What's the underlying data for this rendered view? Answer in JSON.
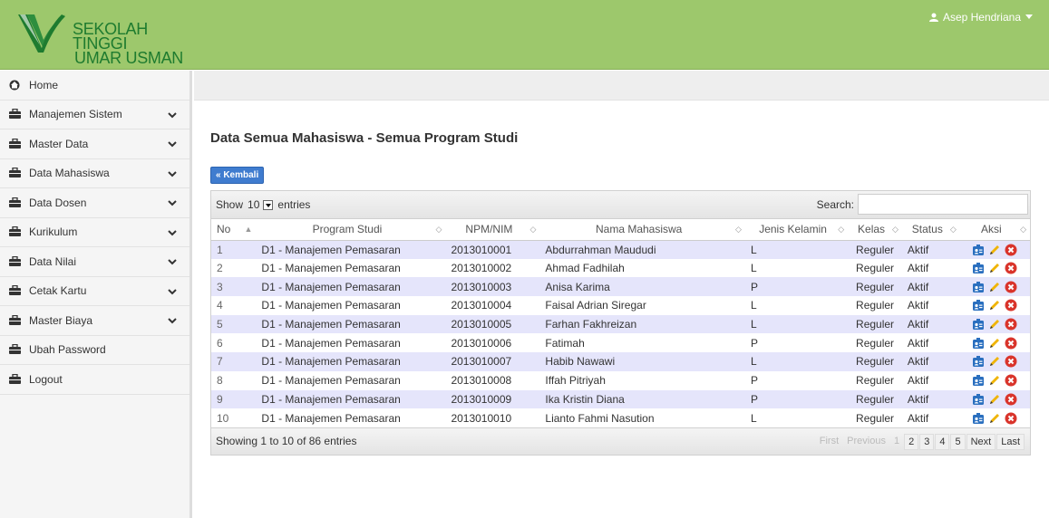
{
  "header": {
    "logo_line1": "SEKOLAH TINGGI",
    "logo_line2": "UMAR USMAN",
    "user_name": "Asep Hendriana"
  },
  "sidebar": {
    "items": [
      {
        "label": "Home",
        "icon": "home-icon",
        "has_chevron": false
      },
      {
        "label": "Manajemen Sistem",
        "icon": "briefcase-icon",
        "has_chevron": true
      },
      {
        "label": "Master Data",
        "icon": "briefcase-icon",
        "has_chevron": true
      },
      {
        "label": "Data Mahasiswa",
        "icon": "briefcase-icon",
        "has_chevron": true
      },
      {
        "label": "Data Dosen",
        "icon": "briefcase-icon",
        "has_chevron": true
      },
      {
        "label": "Kurikulum",
        "icon": "briefcase-icon",
        "has_chevron": true
      },
      {
        "label": "Data Nilai",
        "icon": "briefcase-icon",
        "has_chevron": true
      },
      {
        "label": "Cetak Kartu",
        "icon": "briefcase-icon",
        "has_chevron": true
      },
      {
        "label": "Master Biaya",
        "icon": "briefcase-icon",
        "has_chevron": true
      },
      {
        "label": "Ubah Password",
        "icon": "briefcase-icon",
        "has_chevron": false
      },
      {
        "label": "Logout",
        "icon": "briefcase-icon",
        "has_chevron": false
      }
    ]
  },
  "main": {
    "title": "Data Semua Mahasiswa - Semua Program Studi",
    "back_label": "« Kembali"
  },
  "datatable": {
    "show_label": "Show",
    "length_value": "10",
    "entries_label": "entries",
    "search_label": "Search:",
    "search_value": "",
    "columns": [
      "No",
      "Program Studi",
      "NPM/NIM",
      "Nama Mahasiswa",
      "Jenis Kelamin",
      "Kelas",
      "Status",
      "Aksi"
    ],
    "rows": [
      [
        "1",
        "D1 - Manajemen Pemasaran",
        "2013010001",
        "Abdurrahman Maududi",
        "L",
        "Reguler",
        "Aktif"
      ],
      [
        "2",
        "D1 - Manajemen Pemasaran",
        "2013010002",
        "Ahmad Fadhilah",
        "L",
        "Reguler",
        "Aktif"
      ],
      [
        "3",
        "D1 - Manajemen Pemasaran",
        "2013010003",
        "Anisa Karima",
        "P",
        "Reguler",
        "Aktif"
      ],
      [
        "4",
        "D1 - Manajemen Pemasaran",
        "2013010004",
        "Faisal Adrian Siregar",
        "L",
        "Reguler",
        "Aktif"
      ],
      [
        "5",
        "D1 - Manajemen Pemasaran",
        "2013010005",
        "Farhan Fakhreizan",
        "L",
        "Reguler",
        "Aktif"
      ],
      [
        "6",
        "D1 - Manajemen Pemasaran",
        "2013010006",
        "Fatimah",
        "P",
        "Reguler",
        "Aktif"
      ],
      [
        "7",
        "D1 - Manajemen Pemasaran",
        "2013010007",
        "Habib Nawawi",
        "L",
        "Reguler",
        "Aktif"
      ],
      [
        "8",
        "D1 - Manajemen Pemasaran",
        "2013010008",
        "Iffah Pitriyah",
        "P",
        "Reguler",
        "Aktif"
      ],
      [
        "9",
        "D1 - Manajemen Pemasaran",
        "2013010009",
        "Ika Kristin Diana",
        "P",
        "Reguler",
        "Aktif"
      ],
      [
        "10",
        "D1 - Manajemen Pemasaran",
        "2013010010",
        "Lianto Fahmi Nasution",
        "L",
        "Reguler",
        "Aktif"
      ]
    ],
    "info": "Showing 1 to 10 of 86 entries",
    "pager": {
      "first": "First",
      "previous": "Previous",
      "pages": [
        "1",
        "2",
        "3",
        "4",
        "5"
      ],
      "current": "1",
      "next": "Next",
      "last": "Last"
    }
  },
  "colors": {
    "header_bg": "#9dc86c",
    "logo_green": "#1e7b2f",
    "odd_row": "#e5e5fb",
    "back_button": "#3f7ccf",
    "delete_icon": "#d9342b",
    "edit_icon": "#f0b400",
    "detail_icon": "#2a6fbf"
  }
}
